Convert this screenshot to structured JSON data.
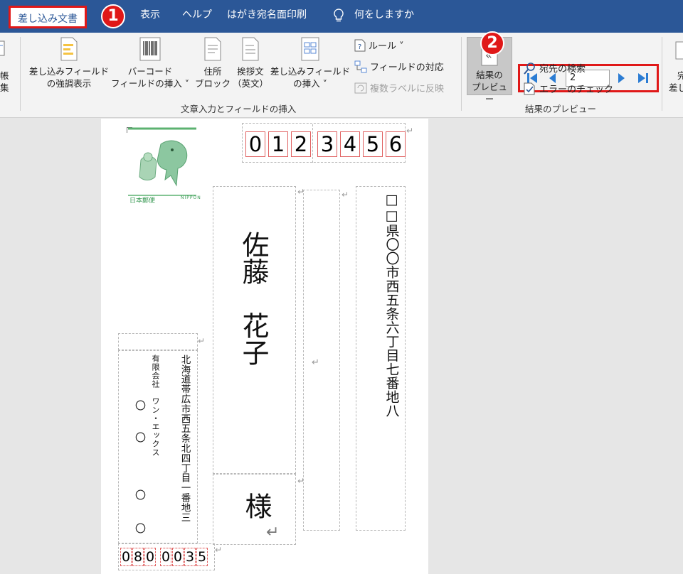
{
  "tabs": {
    "mailings": "差し込み文書",
    "view": "表示",
    "help": "ヘルプ",
    "postcard": "はがき宛名面印刷",
    "tellme": "何をしますか"
  },
  "callouts": {
    "one": "1",
    "two": "2"
  },
  "ribbon": {
    "partial_left_1": "帳",
    "partial_left_2": "集",
    "highlight_fields": [
      "差し込みフィールド",
      "の強調表示"
    ],
    "barcode_field": [
      "バーコード",
      "フィールドの挿入 ˅"
    ],
    "address_block": [
      "住所",
      "ブロック"
    ],
    "greeting_line": [
      "挨拶文",
      "（英文）"
    ],
    "insert_merge_field": [
      "差し込みフィールド",
      "の挿入 ˅"
    ],
    "rules": "ルール ˅",
    "match_fields": "フィールドの対応",
    "update_labels": "複数ラベルに反映",
    "group_write_insert": "文章入力とフィールドの挿入",
    "preview_results": [
      "結果の",
      "プレビュー"
    ],
    "record_number": "2",
    "find_recipient": "宛先の検索",
    "check_errors": "エラーのチェック",
    "group_preview": "結果のプレビュー",
    "partial_right_1": "完",
    "partial_right_2": "差し"
  },
  "postcard": {
    "postal_code_digits": [
      "0",
      "1",
      "2",
      "3",
      "4",
      "5",
      "6"
    ],
    "stamp_text_left": "日本郵便",
    "stamp_text_right": "NIPPON",
    "recipient_name": "佐藤　花子",
    "honorific": "様",
    "recipient_address": "□□県〇〇市西五条六丁目七番地八",
    "sender_address": "北海道帯広市西五条北四丁目一番地三",
    "sender_company": "有限会社　ワン・エックス",
    "sender_circles": [
      "〇",
      "〇",
      "〇",
      "〇"
    ],
    "sender_postal_digits": [
      "0",
      "8",
      "0",
      "0",
      "0",
      "3",
      "5"
    ]
  },
  "colors": {
    "accent": "#2b5797",
    "highlight": "#e01818",
    "field_border": "#e06060"
  }
}
